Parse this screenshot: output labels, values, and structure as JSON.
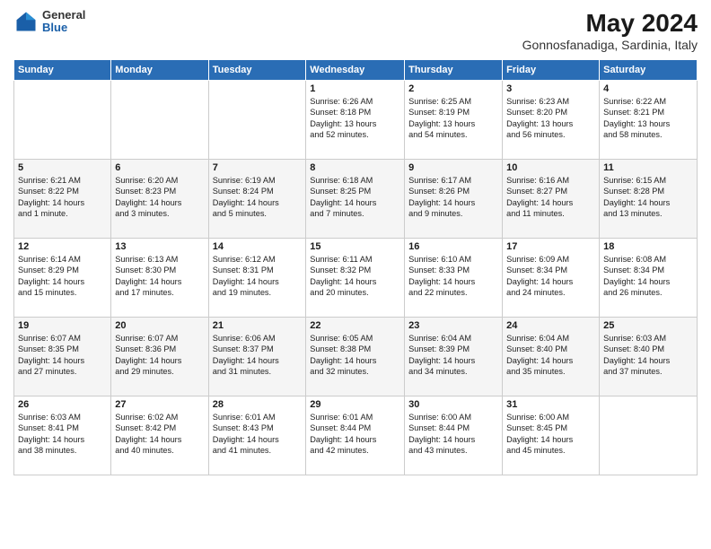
{
  "logo": {
    "general": "General",
    "blue": "Blue"
  },
  "header": {
    "title": "May 2024",
    "subtitle": "Gonnosfanadiga, Sardinia, Italy"
  },
  "weekdays": [
    "Sunday",
    "Monday",
    "Tuesday",
    "Wednesday",
    "Thursday",
    "Friday",
    "Saturday"
  ],
  "weeks": [
    [
      {
        "day": "",
        "info": ""
      },
      {
        "day": "",
        "info": ""
      },
      {
        "day": "",
        "info": ""
      },
      {
        "day": "1",
        "info": "Sunrise: 6:26 AM\nSunset: 8:18 PM\nDaylight: 13 hours\nand 52 minutes."
      },
      {
        "day": "2",
        "info": "Sunrise: 6:25 AM\nSunset: 8:19 PM\nDaylight: 13 hours\nand 54 minutes."
      },
      {
        "day": "3",
        "info": "Sunrise: 6:23 AM\nSunset: 8:20 PM\nDaylight: 13 hours\nand 56 minutes."
      },
      {
        "day": "4",
        "info": "Sunrise: 6:22 AM\nSunset: 8:21 PM\nDaylight: 13 hours\nand 58 minutes."
      }
    ],
    [
      {
        "day": "5",
        "info": "Sunrise: 6:21 AM\nSunset: 8:22 PM\nDaylight: 14 hours\nand 1 minute."
      },
      {
        "day": "6",
        "info": "Sunrise: 6:20 AM\nSunset: 8:23 PM\nDaylight: 14 hours\nand 3 minutes."
      },
      {
        "day": "7",
        "info": "Sunrise: 6:19 AM\nSunset: 8:24 PM\nDaylight: 14 hours\nand 5 minutes."
      },
      {
        "day": "8",
        "info": "Sunrise: 6:18 AM\nSunset: 8:25 PM\nDaylight: 14 hours\nand 7 minutes."
      },
      {
        "day": "9",
        "info": "Sunrise: 6:17 AM\nSunset: 8:26 PM\nDaylight: 14 hours\nand 9 minutes."
      },
      {
        "day": "10",
        "info": "Sunrise: 6:16 AM\nSunset: 8:27 PM\nDaylight: 14 hours\nand 11 minutes."
      },
      {
        "day": "11",
        "info": "Sunrise: 6:15 AM\nSunset: 8:28 PM\nDaylight: 14 hours\nand 13 minutes."
      }
    ],
    [
      {
        "day": "12",
        "info": "Sunrise: 6:14 AM\nSunset: 8:29 PM\nDaylight: 14 hours\nand 15 minutes."
      },
      {
        "day": "13",
        "info": "Sunrise: 6:13 AM\nSunset: 8:30 PM\nDaylight: 14 hours\nand 17 minutes."
      },
      {
        "day": "14",
        "info": "Sunrise: 6:12 AM\nSunset: 8:31 PM\nDaylight: 14 hours\nand 19 minutes."
      },
      {
        "day": "15",
        "info": "Sunrise: 6:11 AM\nSunset: 8:32 PM\nDaylight: 14 hours\nand 20 minutes."
      },
      {
        "day": "16",
        "info": "Sunrise: 6:10 AM\nSunset: 8:33 PM\nDaylight: 14 hours\nand 22 minutes."
      },
      {
        "day": "17",
        "info": "Sunrise: 6:09 AM\nSunset: 8:34 PM\nDaylight: 14 hours\nand 24 minutes."
      },
      {
        "day": "18",
        "info": "Sunrise: 6:08 AM\nSunset: 8:34 PM\nDaylight: 14 hours\nand 26 minutes."
      }
    ],
    [
      {
        "day": "19",
        "info": "Sunrise: 6:07 AM\nSunset: 8:35 PM\nDaylight: 14 hours\nand 27 minutes."
      },
      {
        "day": "20",
        "info": "Sunrise: 6:07 AM\nSunset: 8:36 PM\nDaylight: 14 hours\nand 29 minutes."
      },
      {
        "day": "21",
        "info": "Sunrise: 6:06 AM\nSunset: 8:37 PM\nDaylight: 14 hours\nand 31 minutes."
      },
      {
        "day": "22",
        "info": "Sunrise: 6:05 AM\nSunset: 8:38 PM\nDaylight: 14 hours\nand 32 minutes."
      },
      {
        "day": "23",
        "info": "Sunrise: 6:04 AM\nSunset: 8:39 PM\nDaylight: 14 hours\nand 34 minutes."
      },
      {
        "day": "24",
        "info": "Sunrise: 6:04 AM\nSunset: 8:40 PM\nDaylight: 14 hours\nand 35 minutes."
      },
      {
        "day": "25",
        "info": "Sunrise: 6:03 AM\nSunset: 8:40 PM\nDaylight: 14 hours\nand 37 minutes."
      }
    ],
    [
      {
        "day": "26",
        "info": "Sunrise: 6:03 AM\nSunset: 8:41 PM\nDaylight: 14 hours\nand 38 minutes."
      },
      {
        "day": "27",
        "info": "Sunrise: 6:02 AM\nSunset: 8:42 PM\nDaylight: 14 hours\nand 40 minutes."
      },
      {
        "day": "28",
        "info": "Sunrise: 6:01 AM\nSunset: 8:43 PM\nDaylight: 14 hours\nand 41 minutes."
      },
      {
        "day": "29",
        "info": "Sunrise: 6:01 AM\nSunset: 8:44 PM\nDaylight: 14 hours\nand 42 minutes."
      },
      {
        "day": "30",
        "info": "Sunrise: 6:00 AM\nSunset: 8:44 PM\nDaylight: 14 hours\nand 43 minutes."
      },
      {
        "day": "31",
        "info": "Sunrise: 6:00 AM\nSunset: 8:45 PM\nDaylight: 14 hours\nand 45 minutes."
      },
      {
        "day": "",
        "info": ""
      }
    ]
  ]
}
